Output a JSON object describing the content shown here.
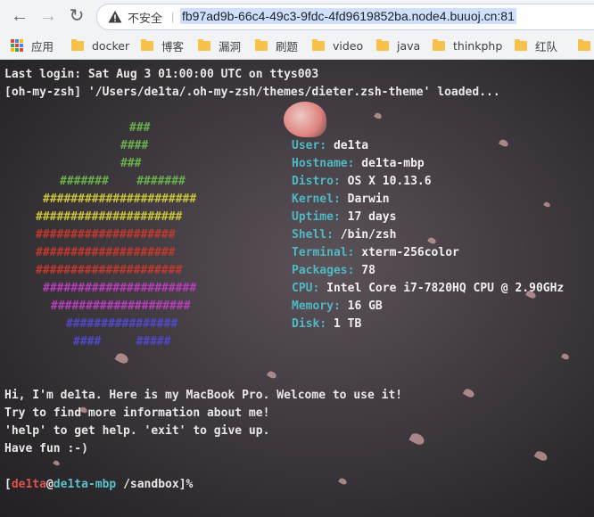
{
  "browser": {
    "security_label": "不安全",
    "url": "fb97ad9b-66c4-49c3-9fdc-4fd9619852ba.node4.buuoj.cn:81",
    "bookmarks": [
      {
        "label": "应用",
        "icon": "apps-grid-icon"
      },
      {
        "label": "docker",
        "icon": "folder-icon"
      },
      {
        "label": "博客",
        "icon": "folder-icon"
      },
      {
        "label": "漏洞",
        "icon": "folder-icon"
      },
      {
        "label": "刷题",
        "icon": "folder-icon"
      },
      {
        "label": "video",
        "icon": "folder-icon"
      },
      {
        "label": "java",
        "icon": "folder-icon"
      },
      {
        "label": "thinkphp",
        "icon": "folder-icon"
      },
      {
        "label": "红队",
        "icon": "folder-icon"
      }
    ]
  },
  "terminal": {
    "last_login": "Last login: Sat Aug 3 01:00:00 UTC on ttys003",
    "zsh_loaded": "[oh-my-zsh] '/Users/de1ta/.oh-my-zsh/themes/dieter.zsh-theme' loaded...",
    "logo_lines": [
      {
        "text": "###",
        "color": "#6ab04c"
      },
      {
        "text": "####",
        "color": "#6ab04c"
      },
      {
        "text": "###",
        "color": "#6ab04c"
      },
      {
        "text": "#######    #######",
        "color": "#6ab04c"
      },
      {
        "text": "######################",
        "color": "#c9c33a"
      },
      {
        "text": "#####################",
        "color": "#c9c33a"
      },
      {
        "text": "####################",
        "color": "#c0392b"
      },
      {
        "text": "####################",
        "color": "#c0392b"
      },
      {
        "text": "#####################",
        "color": "#c0392b"
      },
      {
        "text": "######################",
        "color": "#b83dba"
      },
      {
        "text": "####################",
        "color": "#b83dba"
      },
      {
        "text": "################",
        "color": "#4f49c9"
      },
      {
        "text": "####     #####",
        "color": "#4f49c9"
      }
    ],
    "info": [
      {
        "key": "User:",
        "value": "de1ta"
      },
      {
        "key": "Hostname:",
        "value": "de1ta-mbp"
      },
      {
        "key": "Distro:",
        "value": "OS X 10.13.6"
      },
      {
        "key": "Kernel:",
        "value": "Darwin"
      },
      {
        "key": "Uptime:",
        "value": "17 days"
      },
      {
        "key": "Shell:",
        "value": "/bin/zsh"
      },
      {
        "key": "Terminal:",
        "value": "xterm-256color"
      },
      {
        "key": "Packages:",
        "value": "78"
      },
      {
        "key": "CPU:",
        "value": "Intel Core i7-7820HQ CPU @ 2.90GHz"
      },
      {
        "key": "Memory:",
        "value": "16 GB"
      },
      {
        "key": "Disk:",
        "value": "1 TB"
      }
    ],
    "welcome": [
      "Hi, I'm de1ta. Here is my MacBook Pro. Welcome to use it!",
      "Try to find more information about me!",
      "'help' to get help. 'exit' to give up.",
      "Have fun :-)"
    ],
    "prompt": {
      "open_bracket": "[",
      "user": "de1ta",
      "at": "@",
      "host": "de1ta-mbp",
      "path": " /sandbox]",
      "symbol": "%"
    }
  },
  "colors": {
    "info_key": "#4fb8c3",
    "prompt_user": "#d9534f",
    "url_highlight": "#cfe0fc"
  }
}
